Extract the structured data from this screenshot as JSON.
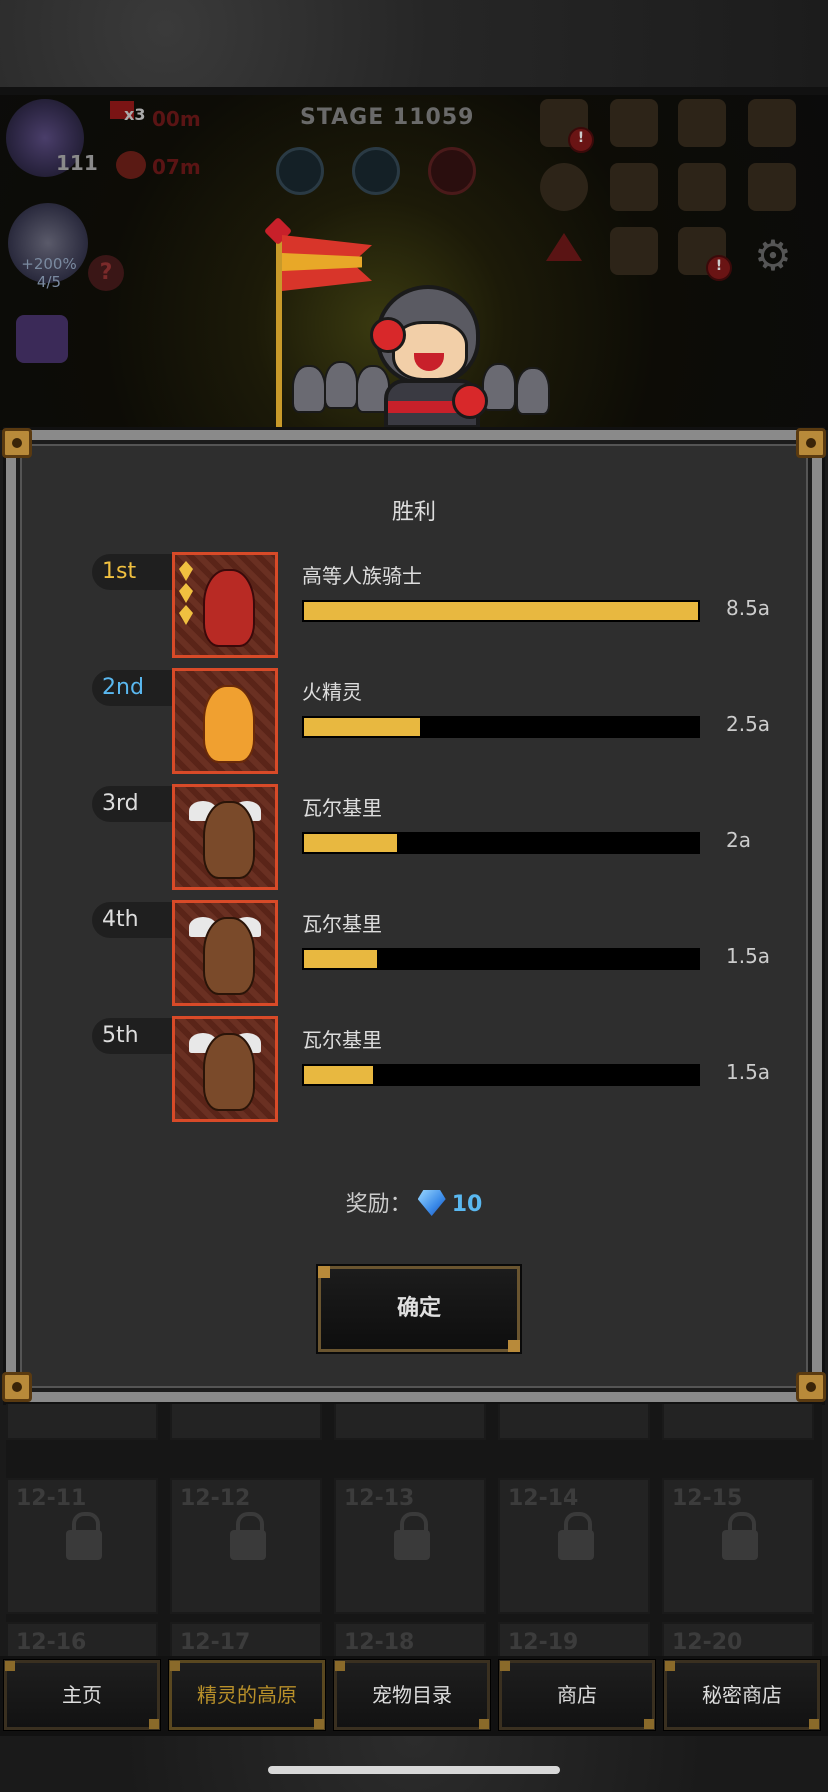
{
  "hud": {
    "stage": "STAGE 11059",
    "boss_count": "111",
    "speed": "x3",
    "timer_top": "00m",
    "timer_bottom": "07m",
    "pet_bonus": "+200%",
    "pet_count": "4/5"
  },
  "dialog": {
    "title": "胜利",
    "rankings": [
      {
        "rank": "1st",
        "name": "高等人族骑士",
        "damage": "8.5a",
        "ratio": 1.0,
        "rank_color": "gold"
      },
      {
        "rank": "2nd",
        "name": "火精灵",
        "damage": "2.5a",
        "ratio": 0.294,
        "rank_color": "blue"
      },
      {
        "rank": "3rd",
        "name": "瓦尔基里",
        "damage": "2a",
        "ratio": 0.235,
        "rank_color": "white"
      },
      {
        "rank": "4th",
        "name": "瓦尔基里",
        "damage": "1.5a",
        "ratio": 0.185,
        "rank_color": "white"
      },
      {
        "rank": "5th",
        "name": "瓦尔基里",
        "damage": "1.5a",
        "ratio": 0.175,
        "rank_color": "white"
      }
    ],
    "reward_label": "奖励：",
    "reward_value": "10",
    "confirm_label": "确定"
  },
  "level_grid": {
    "row2": [
      "12-11",
      "12-12",
      "12-13",
      "12-14",
      "12-15"
    ],
    "row3": [
      "12-16",
      "12-17",
      "12-18",
      "12-19",
      "12-20"
    ]
  },
  "nav": {
    "items": [
      "主页",
      "精灵的高原",
      "宠物目录",
      "商店",
      "秘密商店"
    ],
    "active_index": 1
  },
  "colors": {
    "bar_fill": "#e8b840",
    "rank_gold": "#f0c040",
    "rank_blue": "#5ab8f0",
    "portrait_border": "#d84a28"
  }
}
